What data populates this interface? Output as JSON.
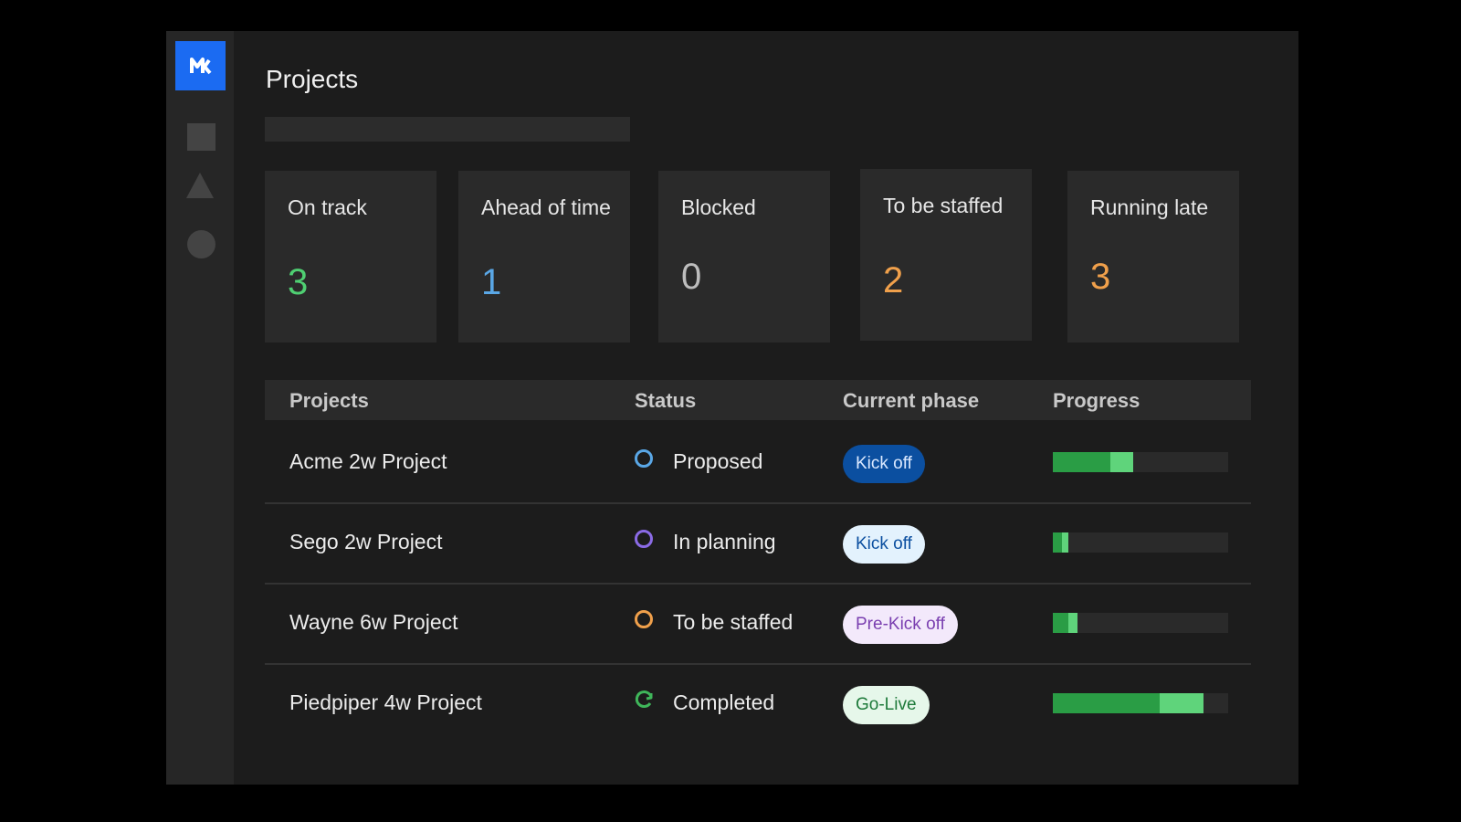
{
  "page": {
    "title": "Projects"
  },
  "search": {
    "placeholder": ""
  },
  "colors": {
    "brand": "#1b6bf2",
    "on_track": "#4fcf72",
    "ahead": "#5aa7e6",
    "blocked": "#bdbdbd",
    "staffed": "#f0a04b",
    "late": "#f0a04b"
  },
  "summary": [
    {
      "label": "On track",
      "value": "3",
      "color": "#4fcf72"
    },
    {
      "label": "Ahead of time",
      "value": "1",
      "color": "#5aa7e6"
    },
    {
      "label": "Blocked",
      "value": "0",
      "color": "#bdbdbd"
    },
    {
      "label": "To be staffed",
      "value": "2",
      "color": "#f0a04b"
    },
    {
      "label": "Running late",
      "value": "3",
      "color": "#f0a04b"
    }
  ],
  "table": {
    "headers": [
      "Projects",
      "Status",
      "Current phase",
      "Progress"
    ],
    "rows": [
      {
        "project": "Acme 2w Project",
        "status": "Proposed",
        "status_icon": "circle-icon",
        "status_color": "#5aa7e6",
        "phase": "Kick off",
        "phase_bg": "#0b4fa0",
        "phase_fg": "#dbe9ff",
        "progress_complete": 0.33,
        "progress_light": 0.13
      },
      {
        "project": "Sego 2w Project",
        "status": "In planning",
        "status_icon": "circle-icon",
        "status_color": "#8b6be6",
        "phase": "Kick off",
        "phase_bg": "#e3f2fd",
        "phase_fg": "#0b4fa0",
        "progress_complete": 0.05,
        "progress_light": 0.04
      },
      {
        "project": "Wayne 6w Project",
        "status": "To be staffed",
        "status_icon": "circle-icon",
        "status_color": "#f0a04b",
        "phase": "Pre-Kick off",
        "phase_bg": "#f3e9fb",
        "phase_fg": "#7a3fb0",
        "progress_complete": 0.09,
        "progress_light": 0.05
      },
      {
        "project": "Piedpiper 4w Project",
        "status": "Completed",
        "status_icon": "check-circle-icon",
        "status_color": "#3fb65a",
        "phase": "Go-Live",
        "phase_bg": "#e6f7ea",
        "phase_fg": "#1e7a3a",
        "progress_complete": 0.61,
        "progress_light": 0.25
      }
    ]
  }
}
